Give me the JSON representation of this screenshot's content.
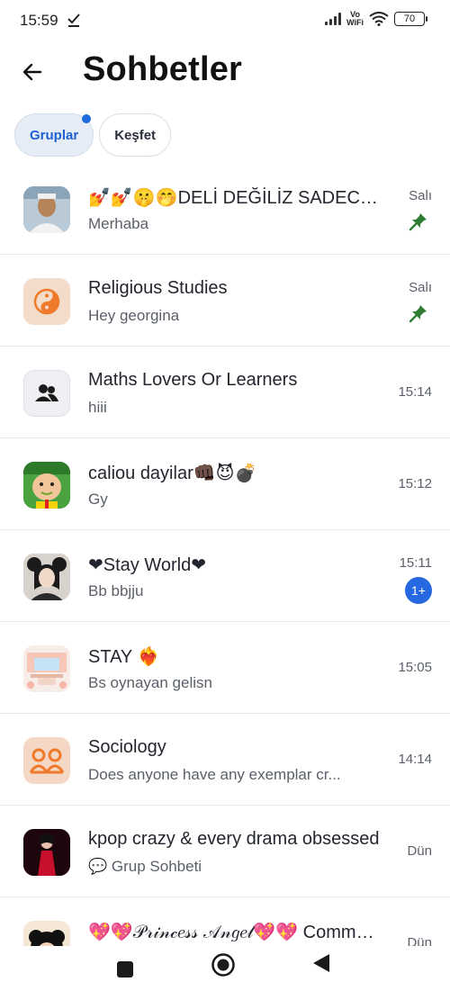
{
  "status": {
    "time": "15:59",
    "vo": "Vo",
    "wifi": "WiFi",
    "battery": "70"
  },
  "header": {
    "title": "Sohbetler"
  },
  "tabs": [
    {
      "label": "Gruplar",
      "active": true,
      "has_dot": true
    },
    {
      "label": "Keşfet",
      "active": false
    }
  ],
  "chats": [
    {
      "name": "💅💅🤫🤭DELİ DEĞİLİZ SADECE FARKLIYIZ",
      "preview": "Merhaba",
      "time": "Salı",
      "pinned": true,
      "avatar": "photo-man-icon"
    },
    {
      "name": "Religious Studies",
      "preview": "Hey georgina",
      "time": "Salı",
      "pinned": true,
      "avatar": "yin-yang-icon"
    },
    {
      "name": "Maths Lovers Or Learners",
      "preview": "hiii",
      "time": "15:14",
      "avatar": "group-icon"
    },
    {
      "name": "caliou dayilar👊🏿😈💣",
      "preview": "Gy",
      "time": "15:12",
      "avatar": "cartoon-boy-icon"
    },
    {
      "name": "❤Stay World❤",
      "preview": "Bb bbjju",
      "time": "15:11",
      "unread": "1+",
      "avatar": "girl-photo-icon"
    },
    {
      "name": "STAY ❤️‍🔥",
      "preview": "Bs oynayan gelisn",
      "time": "15:05",
      "avatar": "room-illustration-icon"
    },
    {
      "name": "Sociology",
      "preview": "Does anyone have any exemplar cr...",
      "time": "14:14",
      "avatar": "people-icon"
    },
    {
      "name": "kpop crazy & every drama obsessed",
      "preview": "💬 Grup Sohbeti",
      "time": "Dün",
      "avatar": "red-dress-photo-icon"
    },
    {
      "name": "💖💖𝒫𝓇𝒾𝓃𝒸𝑒𝓈𝓈 𝒜𝓃𝑔𝑒𝓁💖💖 Community",
      "preview": "",
      "time": "Dün",
      "avatar": "cartoon-hair-icon"
    }
  ],
  "colors": {
    "accent": "#1f5fd6",
    "pin": "#2e7d32",
    "unread": "#2568e0"
  }
}
